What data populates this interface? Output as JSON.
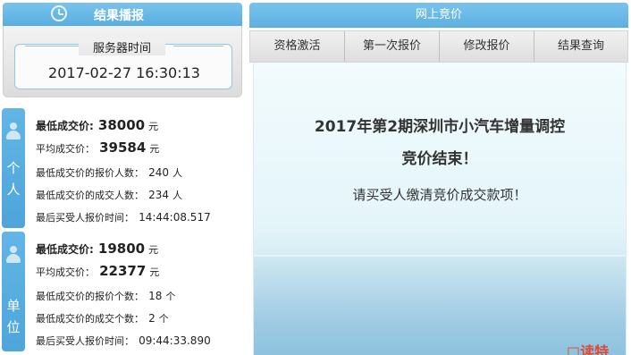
{
  "left_header": {
    "title": "结果播报",
    "icon": "clock-icon"
  },
  "server_time": {
    "label": "服务器时间",
    "value": "2017-02-27 16:30:13"
  },
  "groups": {
    "individual": {
      "tab_chars": [
        "个",
        "人"
      ],
      "icon": "person-icon",
      "min_price_label": "最低成交价:",
      "min_price": "38000",
      "avg_price_label": "平均成交价：",
      "avg_price": "39584",
      "price_unit": "元",
      "bid_count_label": "最低成交价的报价人数：",
      "bid_count": "240",
      "deal_count_label": "最低成交价的成交人数：",
      "deal_count": "234",
      "count_unit": "人",
      "last_time_label": "最后买受人报价时间：",
      "last_time": "14:44:08.517"
    },
    "unit": {
      "tab_chars": [
        "单",
        "位"
      ],
      "icon": "group-icon",
      "min_price_label": "最低成交价:",
      "min_price": "19800",
      "avg_price_label": "平均成交价：",
      "avg_price": "22377",
      "price_unit": "元",
      "bid_count_label": "最低成交价的报价个数：",
      "bid_count": "18",
      "deal_count_label": "最低成交价的成交个数：",
      "deal_count": "2",
      "count_unit": "个",
      "last_time_label": "最后买受人报价时间：",
      "last_time": "09:44:33.890"
    }
  },
  "right_header": {
    "title": "网上竞价"
  },
  "tabs": [
    "资格激活",
    "第一次报价",
    "修改报价",
    "结果查询"
  ],
  "notice": {
    "line1": "2017年第2期深圳市小汽车增量调控",
    "line2": "竞价结束！",
    "line3": "请买受人缴清竞价成交款项！"
  },
  "watermark": "□读特"
}
